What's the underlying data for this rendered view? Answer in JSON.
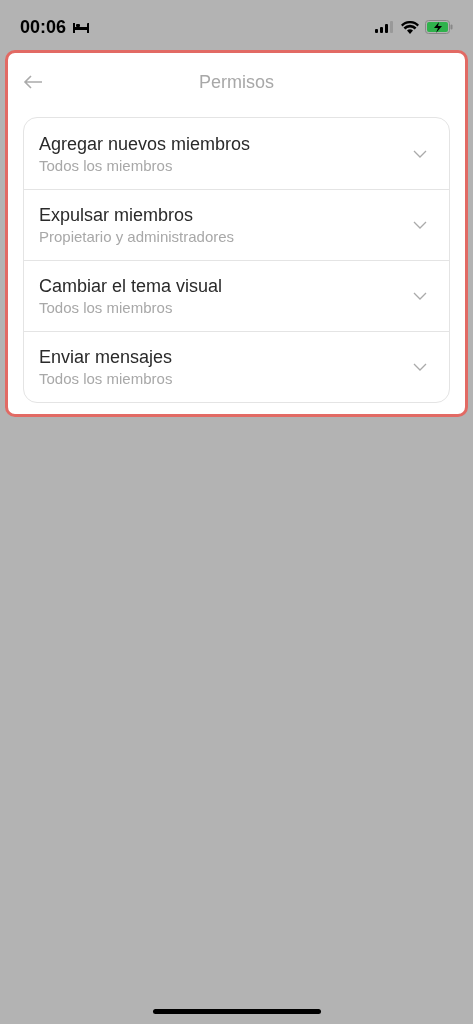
{
  "status_bar": {
    "time": "00:06"
  },
  "header": {
    "title": "Permisos"
  },
  "permissions": [
    {
      "title": "Agregar nuevos miembros",
      "value": "Todos los miembros"
    },
    {
      "title": "Expulsar miembros",
      "value": "Propietario y administradores"
    },
    {
      "title": "Cambiar el tema visual",
      "value": "Todos los miembros"
    },
    {
      "title": "Enviar mensajes",
      "value": "Todos los miembros"
    }
  ]
}
